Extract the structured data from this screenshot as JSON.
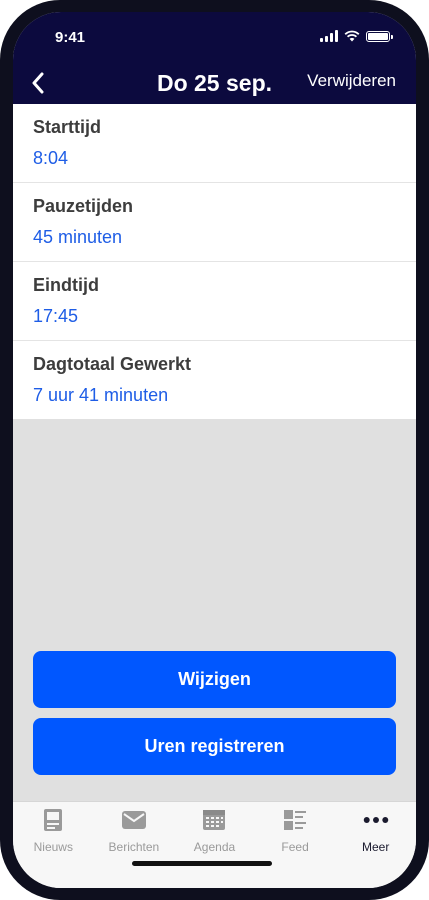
{
  "status_bar": {
    "time": "9:41"
  },
  "nav": {
    "title": "Do 25 sep.",
    "delete_label": "Verwijderen"
  },
  "rows": [
    {
      "label": "Starttijd",
      "value": "8:04"
    },
    {
      "label": "Pauzetijden",
      "value": "45 minuten"
    },
    {
      "label": "Eindtijd",
      "value": "17:45"
    },
    {
      "label": "Dagtotaal Gewerkt",
      "value": "7 uur 41 minuten"
    }
  ],
  "buttons": {
    "edit_label": "Wijzigen",
    "register_label": "Uren registreren"
  },
  "tabs": [
    {
      "label": "Nieuws",
      "icon": "newspaper-icon",
      "active": false
    },
    {
      "label": "Berichten",
      "icon": "envelope-icon",
      "active": false
    },
    {
      "label": "Agenda",
      "icon": "calendar-icon",
      "active": false
    },
    {
      "label": "Feed",
      "icon": "feed-icon",
      "active": false
    },
    {
      "label": "Meer",
      "icon": "more-icon",
      "active": true
    }
  ],
  "colors": {
    "header": "#0c0a3e",
    "accent": "#0057ff",
    "value_text": "#1e5de6",
    "background": "#e0e0e0"
  }
}
